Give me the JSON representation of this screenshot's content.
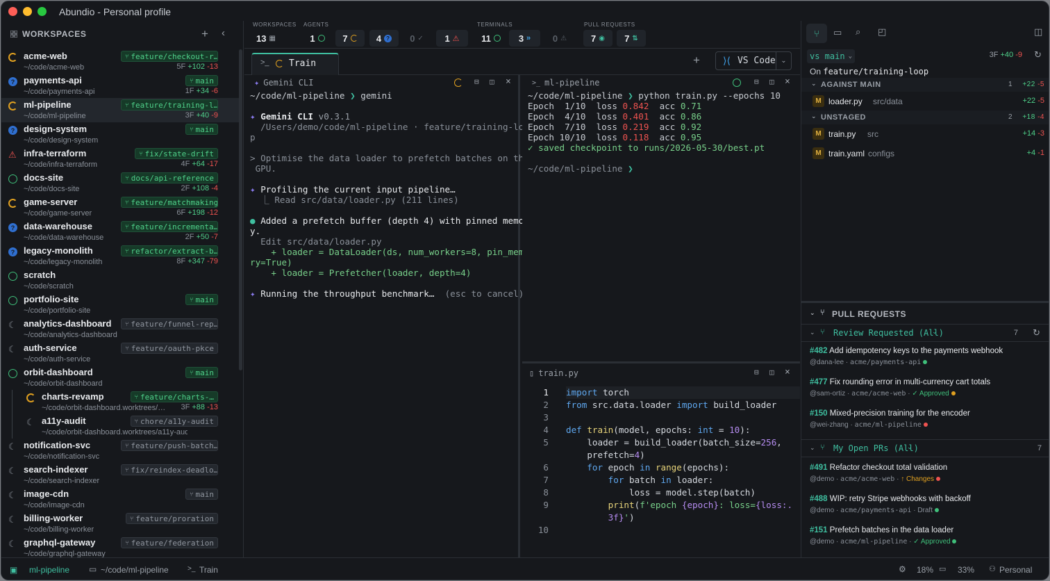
{
  "window": {
    "title": "Abundio - Personal profile"
  },
  "sidebar": {
    "header": "WORKSPACES",
    "items": [
      {
        "name": "acme-web",
        "path": "~/code/acme-web",
        "branch": "feature/checkout-r…",
        "files": "5F",
        "add": "+102",
        "del": "-13",
        "status": "running",
        "branch_style": "green"
      },
      {
        "name": "payments-api",
        "path": "~/code/payments-api",
        "branch": "main",
        "files": "1F",
        "add": "+34",
        "del": "-6",
        "status": "question",
        "branch_style": "green"
      },
      {
        "name": "ml-pipeline",
        "path": "~/code/ml-pipeline",
        "branch": "feature/training-l…",
        "files": "3F",
        "add": "+40",
        "del": "-9",
        "status": "running",
        "branch_style": "green",
        "active": true
      },
      {
        "name": "design-system",
        "path": "~/code/design-system",
        "branch": "main",
        "files": "",
        "add": "",
        "del": "",
        "status": "question",
        "branch_style": "green"
      },
      {
        "name": "infra-terraform",
        "path": "~/code/infra-terraform",
        "branch": "fix/state-drift",
        "files": "4F",
        "add": "+64",
        "del": "-17",
        "status": "error",
        "branch_style": "green"
      },
      {
        "name": "docs-site",
        "path": "~/code/docs-site",
        "branch": "docs/api-reference",
        "files": "2F",
        "add": "+108",
        "del": "-4",
        "status": "idle",
        "branch_style": "green"
      },
      {
        "name": "game-server",
        "path": "~/code/game-server",
        "branch": "feature/matchmaking",
        "files": "6F",
        "add": "+198",
        "del": "-12",
        "status": "running",
        "branch_style": "green"
      },
      {
        "name": "data-warehouse",
        "path": "~/code/data-warehouse",
        "branch": "feature/incrementa…",
        "files": "2F",
        "add": "+50",
        "del": "-7",
        "status": "question",
        "branch_style": "green"
      },
      {
        "name": "legacy-monolith",
        "path": "~/code/legacy-monolith",
        "branch": "refactor/extract-b…",
        "files": "8F",
        "add": "+347",
        "del": "-79",
        "status": "question",
        "branch_style": "green"
      },
      {
        "name": "scratch",
        "path": "~/code/scratch",
        "branch": "",
        "files": "",
        "add": "",
        "del": "",
        "status": "idle",
        "branch_style": "none"
      },
      {
        "name": "portfolio-site",
        "path": "~/code/portfolio-site",
        "branch": "main",
        "files": "",
        "add": "",
        "del": "",
        "status": "idle",
        "branch_style": "green"
      },
      {
        "name": "analytics-dashboard",
        "path": "~/code/analytics-dashboard",
        "branch": "feature/funnel-rep…",
        "files": "",
        "add": "",
        "del": "",
        "status": "sleep",
        "branch_style": "neutral"
      },
      {
        "name": "auth-service",
        "path": "~/code/auth-service",
        "branch": "feature/oauth-pkce",
        "files": "",
        "add": "",
        "del": "",
        "status": "sleep",
        "branch_style": "neutral"
      },
      {
        "name": "orbit-dashboard",
        "path": "~/code/orbit-dashboard",
        "branch": "main",
        "files": "",
        "add": "",
        "del": "",
        "status": "idle",
        "branch_style": "green"
      },
      {
        "name": "charts-revamp",
        "path": "~/code/orbit-dashboard.worktrees/…",
        "branch": "feature/charts-…",
        "files": "3F",
        "add": "+88",
        "del": "-13",
        "status": "running",
        "branch_style": "green",
        "sub": true
      },
      {
        "name": "a11y-audit",
        "path": "~/code/orbit-dashboard.worktrees/a11y-audit",
        "branch": "chore/a11y-audit",
        "files": "",
        "add": "",
        "del": "",
        "status": "sleep",
        "branch_style": "neutral",
        "sub": true
      },
      {
        "name": "notification-svc",
        "path": "~/code/notification-svc",
        "branch": "feature/push-batch…",
        "files": "",
        "add": "",
        "del": "",
        "status": "sleep",
        "branch_style": "neutral"
      },
      {
        "name": "search-indexer",
        "path": "~/code/search-indexer",
        "branch": "fix/reindex-deadlo…",
        "files": "",
        "add": "",
        "del": "",
        "status": "sleep",
        "branch_style": "neutral"
      },
      {
        "name": "image-cdn",
        "path": "~/code/image-cdn",
        "branch": "main",
        "files": "",
        "add": "",
        "del": "",
        "status": "sleep",
        "branch_style": "neutral"
      },
      {
        "name": "billing-worker",
        "path": "~/code/billing-worker",
        "branch": "feature/proration",
        "files": "",
        "add": "",
        "del": "",
        "status": "sleep",
        "branch_style": "neutral"
      },
      {
        "name": "graphql-gateway",
        "path": "~/code/graphql-gateway",
        "branch": "feature/federation",
        "files": "",
        "add": "",
        "del": "",
        "status": "sleep",
        "branch_style": "neutral"
      }
    ]
  },
  "topbar": {
    "workspaces_label": "WORKSPACES",
    "agents_label": "AGENTS",
    "terminals_label": "TERMINALS",
    "prs_label": "PULL REQUESTS",
    "workspaces_count": "13",
    "agents": [
      "1",
      "7",
      "4",
      "0",
      "1"
    ],
    "terminals": [
      "11",
      "3",
      "0"
    ],
    "prs": [
      "7",
      "7"
    ]
  },
  "tabs": {
    "active": "Train",
    "vscode": "VS Code"
  },
  "gemini": {
    "title": "Gemini CLI",
    "prompt_path": "~/code/ml-pipeline",
    "prompt_cmd": "gemini",
    "cli_name": "Gemini CLI",
    "cli_version": "v0.3.1",
    "cli_path1": "/Users/demo/code/ml-pipeline · feature/training-loo",
    "cli_path2": "p",
    "user1": "> Optimise the data loader to prefetch batches on the",
    "user2": " GPU.",
    "step1": "Profiling the current input pipeline…",
    "step1b": "⎿ Read src/data/loader.py (211 lines)",
    "step2a": "Added a prefetch buffer (depth 4) with pinned memor",
    "step2b": "y.",
    "edit": "Edit src/data/loader.py",
    "add1a": "+ loader = DataLoader(ds, num_workers=8, pin_memo",
    "add1b": "ry=True)",
    "add2": "+ loader = Prefetcher(loader, depth=4)",
    "step3": "Running the throughput benchmark…",
    "step3b": "(esc to cancel)"
  },
  "mlterm": {
    "title": "ml-pipeline",
    "prompt_path": "~/code/ml-pipeline",
    "cmd": "python train.py --epochs 10",
    "epochs": [
      {
        "ep": "Epoch  1/10",
        "loss": "0.842",
        "acc": "0.71"
      },
      {
        "ep": "Epoch  4/10",
        "loss": "0.401",
        "acc": "0.86"
      },
      {
        "ep": "Epoch  7/10",
        "loss": "0.219",
        "acc": "0.92"
      },
      {
        "ep": "Epoch 10/10",
        "loss": "0.118",
        "acc": "0.95"
      }
    ],
    "saved": "✓ saved checkpoint to runs/2026-05-30/best.pt",
    "prompt2": "~/code/ml-pipeline"
  },
  "editor": {
    "filename": "train.py"
  },
  "right": {
    "compare": "vs main",
    "stats_files": "3F",
    "stats_add": "+40",
    "stats_del": "-9",
    "on_label": "On",
    "branch": "feature/training-loop",
    "against_main": "AGAINST MAIN",
    "against_count": "1",
    "against_add": "+22",
    "against_del": "-5",
    "unstaged": "UNSTAGED",
    "unstaged_count": "2",
    "unstaged_add": "+18",
    "unstaged_del": "-4",
    "files": [
      {
        "name": "loader.py",
        "dir": "src/data",
        "add": "+22",
        "del": "-5"
      },
      {
        "name": "train.py",
        "dir": "src",
        "add": "+14",
        "del": "-3"
      },
      {
        "name": "train.yaml",
        "dir": "configs",
        "add": "+4",
        "del": "-1"
      }
    ],
    "pr_header": "PULL REQUESTS",
    "review_label": "Review Requested (All)",
    "review_count": "7",
    "review": [
      {
        "num": "#482",
        "title": "Add idempotency keys to the payments webhook",
        "user": "@dana-lee",
        "repo": "acme/payments-api",
        "status": "",
        "dot": "#3fbf7a"
      },
      {
        "num": "#477",
        "title": "Fix rounding error in multi-currency cart totals",
        "user": "@sam-ortiz",
        "repo": "acme/acme-web",
        "status": "✓ Approved",
        "dot": "#e0a020"
      },
      {
        "num": "#150",
        "title": "Mixed-precision training for the encoder",
        "user": "@wei-zhang",
        "repo": "acme/ml-pipeline",
        "status": "",
        "dot": "#ef5350"
      }
    ],
    "mine_label": "My Open PRs (All)",
    "mine_count": "7",
    "mine": [
      {
        "num": "#491",
        "title": "Refactor checkout total validation",
        "user": "@demo",
        "repo": "acme/acme-web",
        "status": "↑ Changes",
        "dot": "#ef5350"
      },
      {
        "num": "#488",
        "title": "WIP: retry Stripe webhooks with backoff",
        "user": "@demo",
        "repo": "acme/payments-api",
        "status": "Draft",
        "dot": "#3fbf7a"
      },
      {
        "num": "#151",
        "title": "Prefetch batches in the data loader",
        "user": "@demo",
        "repo": "acme/ml-pipeline",
        "status": "✓ Approved",
        "dot": "#3fbf7a"
      }
    ]
  },
  "status": {
    "workspace": "ml-pipeline",
    "path": "~/code/ml-pipeline",
    "tab": "Train",
    "cpu": "18%",
    "mem": "33%",
    "profile": "Personal"
  }
}
